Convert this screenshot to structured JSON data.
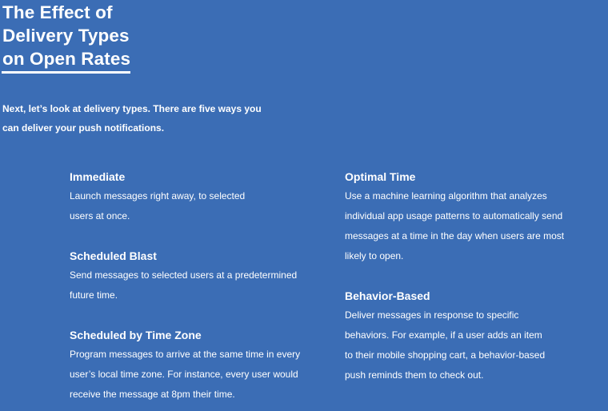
{
  "title": {
    "lines": [
      "The Effect of",
      "Delivery Types",
      "on Open Rates"
    ]
  },
  "intro": {
    "lines": [
      "Next, let’s look at delivery types. There are five ways you",
      "can deliver your push notifications."
    ]
  },
  "delivery_types": [
    {
      "heading": "Immediate",
      "lines": [
        "Launch messages right away, to selected",
        "users at once."
      ]
    },
    {
      "heading": "Scheduled Blast",
      "lines": [
        "Send messages to selected users at a predetermined",
        "future time."
      ]
    },
    {
      "heading": "Scheduled by Time Zone",
      "lines": [
        "Program messages to arrive at the same time in every",
        "user’s local time zone. For instance, every user would",
        "receive the message at 8pm their time."
      ]
    },
    {
      "heading": "Optimal Time",
      "lines": [
        "Use a machine learning algorithm that analyzes",
        "individual app usage patterns to automatically send",
        "messages at a time in the day when users are most",
        "likely to open."
      ]
    },
    {
      "heading": "Behavior-Based",
      "lines": [
        "Deliver messages in response to specific",
        "behaviors. For example, if a user adds an item",
        "to their mobile shopping cart, a behavior-based",
        "push reminds them to check out."
      ]
    }
  ],
  "colors": {
    "background": "#3b6db5",
    "text": "#ffffff"
  }
}
